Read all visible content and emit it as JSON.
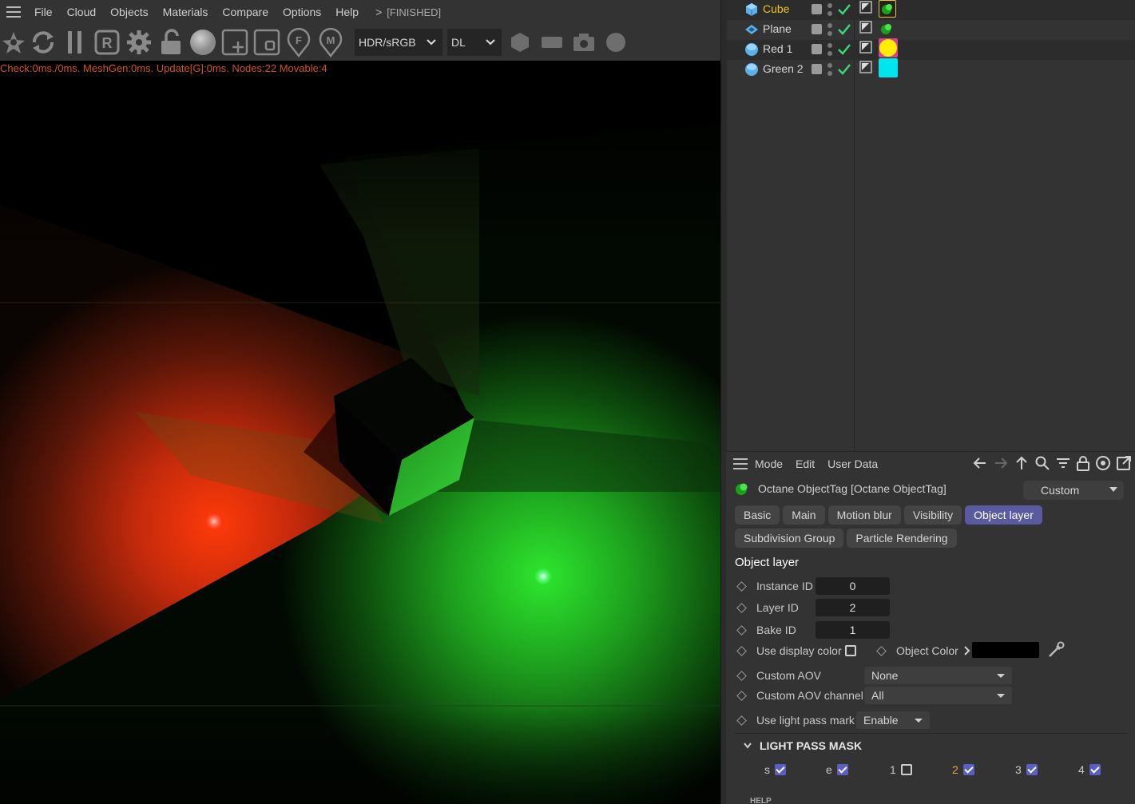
{
  "menubar": {
    "items": [
      "File",
      "Cloud",
      "Objects",
      "Materials",
      "Compare",
      "Options",
      "Help"
    ],
    "arrow": ">",
    "status": "[FINISHED]"
  },
  "toolbar": {
    "color_mode": "HDR/sRGB",
    "kernel": "DL",
    "icons": [
      "octane-logo-icon",
      "refresh-icon",
      "pause-icon",
      "render-region-icon",
      "settings-gear-icon",
      "lock-icon",
      "sphere-icon",
      "add-region-icon",
      "film-region-icon",
      "focus-pick-icon",
      "material-pick-icon"
    ],
    "right_icons": [
      "hexagon-icon",
      "rectangle-icon",
      "camera-icon",
      "circle-icon"
    ]
  },
  "perf_text": "Check:0ms./0ms. MeshGen:0ms. Update[G]:0ms. Nodes:22 Movable:4",
  "objects": [
    {
      "name": "Cube",
      "type": "cube",
      "tag_color": "#1aa01a",
      "active": true
    },
    {
      "name": "Plane",
      "type": "plane",
      "tag_color": "#1aa01a",
      "active": false
    },
    {
      "name": "Red 1",
      "type": "sphere",
      "tag_color": "#ffee00",
      "active": false
    },
    {
      "name": "Green 2",
      "type": "sphere",
      "tag_color": "#00e5ee",
      "active": false
    }
  ],
  "attr": {
    "menu": [
      "Mode",
      "Edit",
      "User Data"
    ],
    "title": "Octane ObjectTag [Octane ObjectTag]",
    "preset": "Custom",
    "tabs_row1": [
      "Basic",
      "Main",
      "Motion blur",
      "Visibility",
      "Object layer"
    ],
    "tabs_row2": [
      "Subdivision Group",
      "Particle Rendering"
    ],
    "active_tab": "Object layer",
    "section": "Object layer",
    "instance_id_label": "Instance ID",
    "instance_id": "0",
    "layer_id_label": "Layer ID",
    "layer_id": "2",
    "bake_id_label": "Bake ID",
    "bake_id": "1",
    "use_display_color_label": "Use display color",
    "object_color_label": "Object Color",
    "object_color": "#000000",
    "custom_aov_label": "Custom AOV",
    "custom_aov": "None",
    "custom_aov_channel_label": "Custom AOV channel",
    "custom_aov_channel": "All",
    "use_light_pass_mark_label": "Use light pass mark",
    "use_light_pass_mark": "Enable",
    "light_pass_mask_title": "LIGHT PASS MASK",
    "light_pass_mask": [
      {
        "label": "s",
        "checked": true,
        "highlight": false
      },
      {
        "label": "e",
        "checked": true,
        "highlight": false
      },
      {
        "label": "1",
        "checked": false,
        "highlight": false
      },
      {
        "label": "2",
        "checked": true,
        "highlight": true
      },
      {
        "label": "3",
        "checked": true,
        "highlight": false
      },
      {
        "label": "4",
        "checked": true,
        "highlight": false
      }
    ],
    "help_label": "HELP"
  },
  "colors": {
    "accent": "#5a5aa0",
    "active_object": "#f0c419",
    "perf_text": "#d2541b",
    "check_green": "#3dd47a"
  }
}
